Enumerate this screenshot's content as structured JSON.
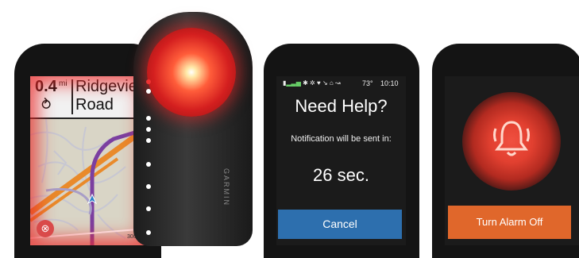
{
  "navigation": {
    "distance": "0.4",
    "unit": "mi",
    "street_line1": "Ridgeviev",
    "street_line2": "Road",
    "scale_label": "300"
  },
  "brand": {
    "light_label": "GARMIN"
  },
  "help_screen": {
    "status_bar": {
      "temperature": "73°",
      "time": "10:10"
    },
    "title": "Need Help?",
    "message": "Notification will be sent in:",
    "countdown": "26 sec.",
    "cancel_label": "Cancel"
  },
  "alarm_screen": {
    "turn_off_label": "Turn Alarm Off"
  },
  "colors": {
    "cancel_button": "#2d6fae",
    "alarm_button": "#e0672b",
    "route": "#7b3fa0",
    "alert_red": "#e24030"
  },
  "icons": [
    "battery-icon",
    "signal-icon",
    "bluetooth-icon",
    "heart-icon",
    "bike-icon",
    "radar-icon",
    "bell-icon",
    "turn-icon",
    "alarm-icon"
  ]
}
